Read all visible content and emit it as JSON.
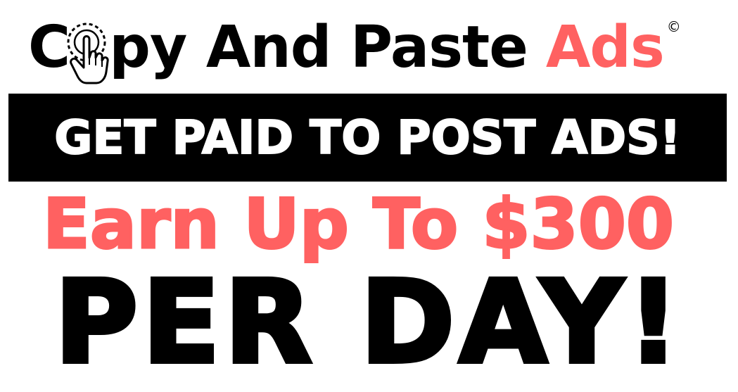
{
  "logo": {
    "letter_c": "C",
    "main_text": "py And Paste",
    "accent_text": "Ads",
    "copyright_symbol": "©",
    "icon": "pointer-hand-tap-icon",
    "accent_color": "#ff6161"
  },
  "banner": {
    "text": "GET PAID TO POST ADS!",
    "background": "#000000",
    "color": "#ffffff"
  },
  "headline": {
    "earn": "Earn Up To $300",
    "per_day": "PER DAY!",
    "earn_color": "#ff6161",
    "per_day_color": "#000000"
  }
}
